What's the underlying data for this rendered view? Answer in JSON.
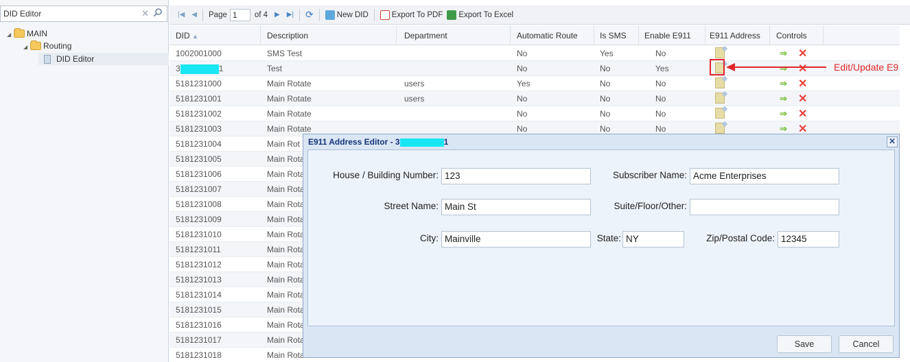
{
  "tree": {
    "search_placeholder": "DID Editor",
    "items": [
      {
        "label": "MAIN"
      },
      {
        "label": "Routing"
      },
      {
        "label": "DID Editor"
      }
    ]
  },
  "toolbar": {
    "page_label": "Page",
    "page_value": "1",
    "of_label": "of 4",
    "new_did": "New DID",
    "export_pdf": "Export To PDF",
    "export_excel": "Export To Excel"
  },
  "grid": {
    "columns": [
      "DID",
      "Description",
      "Department",
      "Automatic Route",
      "Is SMS",
      "Enable E911",
      "E911 Address",
      "Controls"
    ],
    "rows": [
      {
        "did": "1002001000",
        "desc": "SMS Test",
        "dept": "",
        "auto": "No",
        "sms": "Yes",
        "e911": "No"
      },
      {
        "did_prefix": "3",
        "did_suffix": "1",
        "desc": "Test",
        "dept": "",
        "auto": "No",
        "sms": "No",
        "e911": "Yes"
      },
      {
        "did": "5181231000",
        "desc": "Main Rotate",
        "dept": "users",
        "auto": "Yes",
        "sms": "No",
        "e911": "No"
      },
      {
        "did": "5181231001",
        "desc": "Main Rotate",
        "dept": "users",
        "auto": "No",
        "sms": "No",
        "e911": "No"
      },
      {
        "did": "5181231002",
        "desc": "Main Rotate",
        "dept": "",
        "auto": "No",
        "sms": "No",
        "e911": "No"
      },
      {
        "did": "5181231003",
        "desc": "Main Rotate",
        "dept": "",
        "auto": "No",
        "sms": "No",
        "e911": "No"
      },
      {
        "did": "5181231004",
        "desc": "Main Rot"
      },
      {
        "did": "5181231005",
        "desc": "Main Rota"
      },
      {
        "did": "5181231006",
        "desc": "Main Rota"
      },
      {
        "did": "5181231007",
        "desc": "Main Rota"
      },
      {
        "did": "5181231008",
        "desc": "Main Rota"
      },
      {
        "did": "5181231009",
        "desc": "Main Rota"
      },
      {
        "did": "5181231010",
        "desc": "Main Rota"
      },
      {
        "did": "5181231011",
        "desc": "Main Rota"
      },
      {
        "did": "5181231012",
        "desc": "Main Rota"
      },
      {
        "did": "5181231013",
        "desc": "Main Rota"
      },
      {
        "did": "5181231014",
        "desc": "Main Rota"
      },
      {
        "did": "5181231015",
        "desc": "Main Rota"
      },
      {
        "did": "5181231016",
        "desc": "Main Rota"
      },
      {
        "did": "5181231017",
        "desc": "Main Rota"
      },
      {
        "did": "5181231018",
        "desc": "Main Rota"
      }
    ]
  },
  "annotation": {
    "text": "Edit/Update E9"
  },
  "modal": {
    "title_prefix": "E911 Address Editor - 3",
    "title_suffix": "1",
    "house_label": "House / Building Number:",
    "house_value": "123",
    "subscriber_label": "Subscriber Name:",
    "subscriber_value": "Acme Enterprises",
    "street_label": "Street Name:",
    "street_value": "Main St",
    "suite_label": "Suite/Floor/Other:",
    "suite_value": "",
    "city_label": "City:",
    "city_value": "Mainville",
    "state_label": "State:",
    "state_value": "NY",
    "zip_label": "Zip/Postal Code:",
    "zip_value": "12345",
    "save": "Save",
    "cancel": "Cancel"
  },
  "colors": {
    "accent": "#14357a",
    "annotation": "#e1262c",
    "redaction": "#18e7f3"
  }
}
